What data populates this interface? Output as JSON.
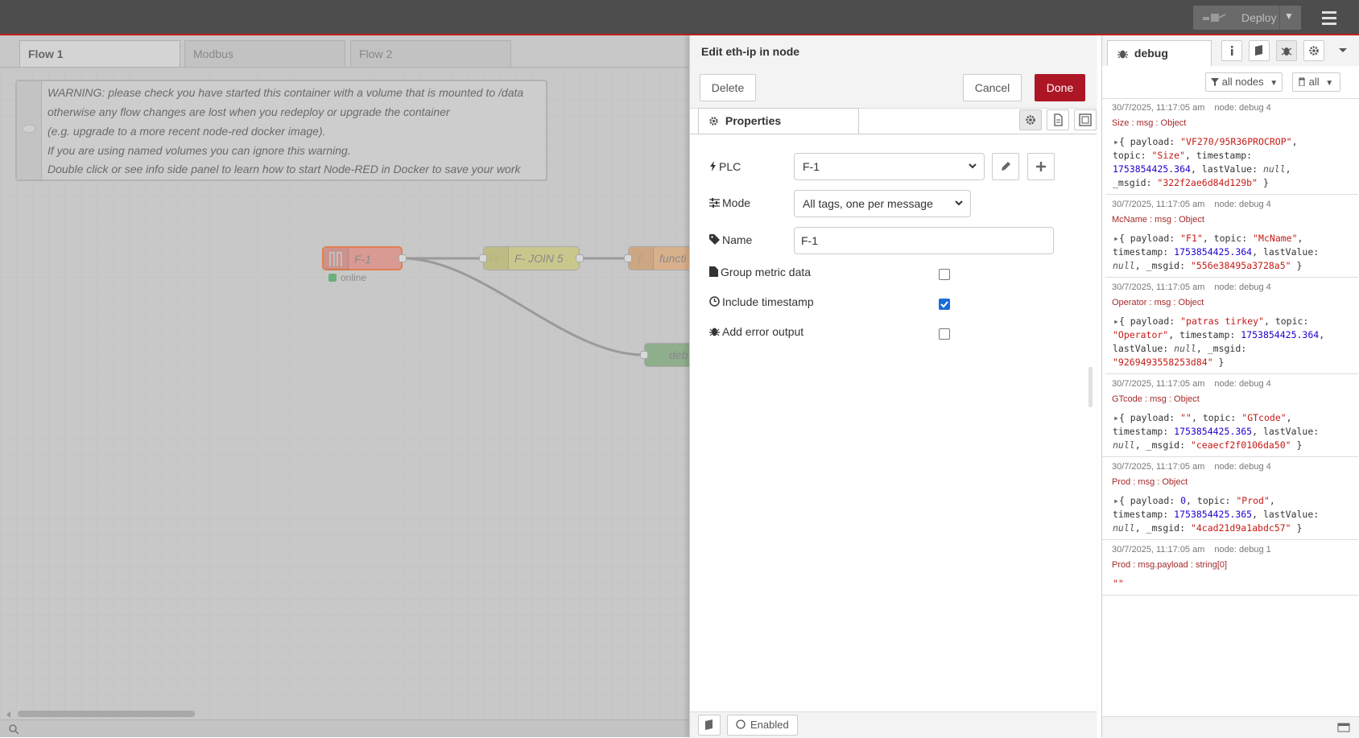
{
  "header": {
    "deploy_label": "Deploy"
  },
  "workspace": {
    "tabs": [
      "Flow 1",
      "Modbus",
      "Flow 2"
    ],
    "comment_lines": [
      "WARNING: please check you have started this container with a volume that is mounted to /data",
      "otherwise any flow changes are lost when you redeploy or upgrade the container",
      "(e.g. upgrade to a more recent node-red docker image).",
      "If you are using named volumes you can ignore this warning.",
      "Double click or see info side panel to learn how to start Node-RED in Docker to save your work"
    ],
    "nodes": {
      "eth": "F-1",
      "eth_status": "online",
      "join": "F- JOIN 5",
      "function": "functi",
      "debug": "deb"
    }
  },
  "tray": {
    "title": "Edit eth-ip in node",
    "delete_label": "Delete",
    "cancel_label": "Cancel",
    "done_label": "Done",
    "properties_tab": "Properties",
    "plc_label": "PLC",
    "plc_value": "F-1",
    "mode_label": "Mode",
    "mode_value": "All tags, one per message",
    "name_label": "Name",
    "name_value": "F-1",
    "group_label": "Group metric data",
    "group_checked": false,
    "timestamp_label": "Include timestamp",
    "timestamp_checked": true,
    "error_label": "Add error output",
    "error_checked": false,
    "enabled_label": "Enabled"
  },
  "sidebar": {
    "tab_label": "debug",
    "filter_label": "all nodes",
    "clear_label": "all",
    "messages": [
      {
        "meta": "30/7/2025, 11:17:05 am",
        "node": "node: debug 4",
        "topic": "Size : msg : Object",
        "lines": [
          [
            [
              "k",
              "{ payload: "
            ],
            [
              "s",
              "\"VF270/95R36PROCROP\""
            ],
            [
              "k",
              ","
            ]
          ],
          [
            [
              "k",
              "topic: "
            ],
            [
              "s",
              "\"Size\""
            ],
            [
              "k",
              ", timestamp:"
            ]
          ],
          [
            [
              "n",
              "1753854425.364"
            ],
            [
              "k",
              ", lastValue: "
            ],
            [
              "nl",
              "null"
            ],
            [
              "k",
              ","
            ]
          ],
          [
            [
              "k",
              "_msgid: "
            ],
            [
              "s",
              "\"322f2ae6d84d129b\""
            ],
            [
              "k",
              " }"
            ]
          ]
        ]
      },
      {
        "meta": "30/7/2025, 11:17:05 am",
        "node": "node: debug 4",
        "topic": "McName : msg : Object",
        "lines": [
          [
            [
              "k",
              "{ payload: "
            ],
            [
              "s",
              "\"F1\""
            ],
            [
              "k",
              ", topic: "
            ],
            [
              "s",
              "\"McName\""
            ],
            [
              "k",
              ","
            ]
          ],
          [
            [
              "k",
              "timestamp: "
            ],
            [
              "n",
              "1753854425.364"
            ],
            [
              "k",
              ", lastValue:"
            ]
          ],
          [
            [
              "nl",
              "null"
            ],
            [
              "k",
              ", _msgid: "
            ],
            [
              "s",
              "\"556e38495a3728a5\""
            ],
            [
              "k",
              " }"
            ]
          ]
        ]
      },
      {
        "meta": "30/7/2025, 11:17:05 am",
        "node": "node: debug 4",
        "topic": "Operator : msg : Object",
        "lines": [
          [
            [
              "k",
              "{ payload: "
            ],
            [
              "s",
              "\"patras tirkey\""
            ],
            [
              "k",
              ", topic:"
            ]
          ],
          [
            [
              "s",
              "\"Operator\""
            ],
            [
              "k",
              ", timestamp: "
            ],
            [
              "n",
              "1753854425.364"
            ],
            [
              "k",
              ","
            ]
          ],
          [
            [
              "k",
              "lastValue: "
            ],
            [
              "nl",
              "null"
            ],
            [
              "k",
              ", _msgid:"
            ]
          ],
          [
            [
              "s",
              "\"9269493558253d84\""
            ],
            [
              "k",
              " }"
            ]
          ]
        ]
      },
      {
        "meta": "30/7/2025, 11:17:05 am",
        "node": "node: debug 4",
        "topic": "GTcode : msg : Object",
        "lines": [
          [
            [
              "k",
              "{ payload: "
            ],
            [
              "s",
              "\"\""
            ],
            [
              "k",
              ", topic: "
            ],
            [
              "s",
              "\"GTcode\""
            ],
            [
              "k",
              ","
            ]
          ],
          [
            [
              "k",
              "timestamp: "
            ],
            [
              "n",
              "1753854425.365"
            ],
            [
              "k",
              ", lastValue:"
            ]
          ],
          [
            [
              "nl",
              "null"
            ],
            [
              "k",
              ", _msgid: "
            ],
            [
              "s",
              "\"ceaecf2f0106da50\""
            ],
            [
              "k",
              " }"
            ]
          ]
        ]
      },
      {
        "meta": "30/7/2025, 11:17:05 am",
        "node": "node: debug 4",
        "topic": "Prod : msg : Object",
        "lines": [
          [
            [
              "k",
              "{ payload: "
            ],
            [
              "n",
              "0"
            ],
            [
              "k",
              ", topic: "
            ],
            [
              "s",
              "\"Prod\""
            ],
            [
              "k",
              ","
            ]
          ],
          [
            [
              "k",
              "timestamp: "
            ],
            [
              "n",
              "1753854425.365"
            ],
            [
              "k",
              ", lastValue:"
            ]
          ],
          [
            [
              "nl",
              "null"
            ],
            [
              "k",
              ", _msgid: "
            ],
            [
              "s",
              "\"4cad21d9a1abdc57\""
            ],
            [
              "k",
              " }"
            ]
          ]
        ]
      },
      {
        "meta": "30/7/2025, 11:17:05 am",
        "node": "node: debug 1",
        "topic": "Prod : msg.payload : string[0]",
        "lines": [
          [
            [
              "s",
              "\"\""
            ]
          ]
        ]
      }
    ]
  }
}
